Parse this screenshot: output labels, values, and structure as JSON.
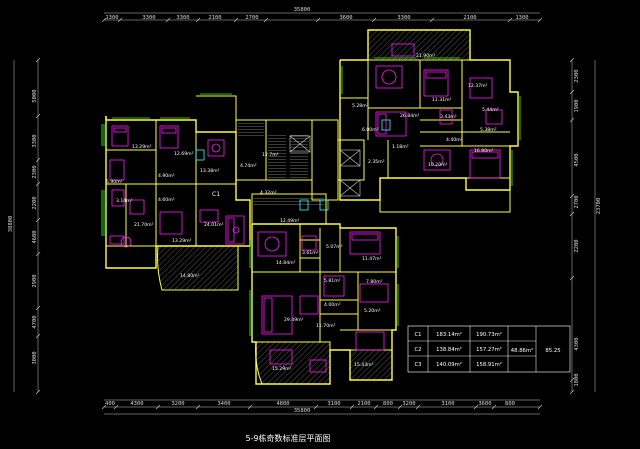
{
  "drawing": {
    "caption": "5-9栋奇数标准层平面图",
    "colors": {
      "background": "#000000",
      "walls": "#ffff33",
      "furniture": "#ff1aff",
      "windows": "#33ff33",
      "dimensions": "#d9d9d9",
      "cyan": "#33ffff"
    }
  },
  "dimensions": {
    "top_total": "35800",
    "top_segments": [
      "1300",
      "3300",
      "3300",
      "2100",
      "2700",
      "3600",
      "3300",
      "2100",
      "1300"
    ],
    "bottom_total": "35800",
    "bottom_segments": [
      "400",
      "4300",
      "3200",
      "3400",
      "4800",
      "3100",
      "2100",
      "800",
      "3200",
      "3100",
      "3600",
      "800"
    ],
    "left_total": "38800",
    "left_segments": [
      "5000",
      "3300",
      "2300",
      "2200",
      "4600",
      "2900",
      "4700",
      "3000"
    ],
    "right_total": "23700",
    "right_segments": [
      "2300",
      "1900",
      "4500",
      "2700",
      "2200",
      "4300",
      "1800"
    ]
  },
  "rooms": [
    "21.90m²",
    "12.37m²",
    "11.31m²",
    "26.84m²",
    "5.28m²",
    "6.00m²",
    "3.43m²",
    "5.44m²",
    "5.38m²",
    "16.80m²",
    "4.40m²",
    "10.20m²",
    "1.18m²",
    "2.35m²",
    "12.7m²",
    "4.74m²",
    "13.29m²",
    "12.69m²",
    "13.38m²",
    "4.90m²",
    "4.60m²",
    "5.90m²",
    "3.14m²",
    "21.70m²",
    "13.29m²",
    "C1",
    "24.01m²",
    "4.32m²",
    "12.49m²",
    "14.80m²",
    "14.84m²",
    "5.07m²",
    "3.61m²",
    "11.47m²",
    "5.81m²",
    "7.80m²",
    "4.00m²",
    "5.20m²",
    "29.49m²",
    "11.70m²",
    "15.29m²",
    "15.43m²"
  ],
  "area_table": {
    "rows": [
      {
        "unit": "C1",
        "usable": "183.14m²",
        "built": "190.73m²"
      },
      {
        "unit": "C2",
        "usable": "138.84m²",
        "built": "157.27m²"
      },
      {
        "unit": "C3",
        "usable": "140.09m²",
        "built": "158.91m²"
      }
    ],
    "shared": "48.86m²",
    "ratio": "85.25"
  }
}
